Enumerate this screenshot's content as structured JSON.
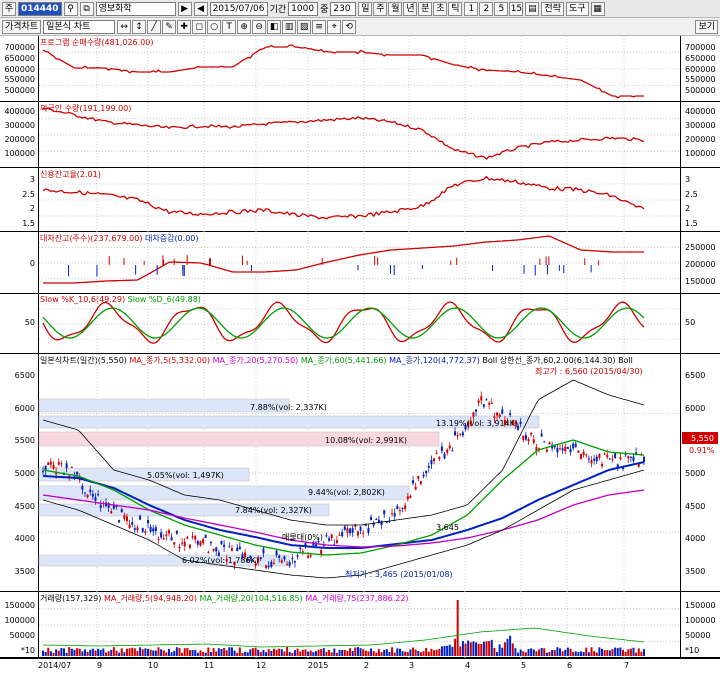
{
  "toolbar": {
    "code": "014440",
    "stock_name": "영보화학",
    "date": "2015/07/06",
    "period_label": "기간",
    "period_value": "1000",
    "count_label": "중",
    "count_value": "230",
    "period_buttons": [
      "일",
      "주",
      "월",
      "년",
      "분",
      "초",
      "틱"
    ],
    "minute_buttons": [
      "1",
      "2",
      "5",
      "15"
    ],
    "strategy": "전략",
    "tools": "도구"
  },
  "toolbar2": {
    "price_chart_tab": "가격차트",
    "chart_type": "일본식 차트",
    "view_label": "보기"
  },
  "panels": {
    "program": {
      "title": "프로그램 순매수량(481,026.00)",
      "ticks": [
        "700000",
        "650000",
        "600000",
        "550000",
        "500000"
      ]
    },
    "foreign": {
      "title": "외국인 수량(191,199.00)",
      "ticks": [
        "400000",
        "300000",
        "200000",
        "100000"
      ]
    },
    "credit": {
      "title": "신용잔고율(2.01)",
      "ticks": [
        "3",
        "2.5",
        "2",
        "1.5"
      ]
    },
    "lending": {
      "title": "대차잔고(주수)(237,679.00)",
      "title2": "대차증감(0.00)",
      "ticks_left": [
        "0"
      ],
      "ticks_right": [
        "250000",
        "200000",
        "150000"
      ]
    },
    "stoch": {
      "title": "Slow %K_10,6(49.29)",
      "title2": "Slow %D_6(49.88)",
      "ticks": [
        "50"
      ]
    },
    "price": {
      "title": "일본식차트(일간)(5,550)",
      "ma1": "MA_종가,5(5,332.00)",
      "ma2": "MA_종가,20(5,270.50)",
      "ma3": "MA_종가,60(5,441.66)",
      "ma4": "MA_종가,120(4,772.37)",
      "boll": "Boll 상한선_종가,60,2.00(6,144.30)",
      "boll2": "Boll",
      "ticks": [
        "6500",
        "6000",
        "5500",
        "5000",
        "4500",
        "4000",
        "3500"
      ],
      "current_price": "5,550",
      "change_pct": "0.91%",
      "high_label": "최고가 : 6,560 (2015/04/30)",
      "low_label": "최저가 : 3,465 (2015/01/08)",
      "zones": [
        "7.88%(vol: 2,337K)",
        "13.19%(vol: 3,914K)",
        "10.08%(vol: 2,991K)",
        "5.05%(vol: 1,497K)",
        "9.44%(vol: 2,802K)",
        "7.84%(vol: 2,327K)",
        "6.02%(vol: 1,786K)"
      ],
      "annot1": "매물대(0%)",
      "annot2": "3,645"
    },
    "volume": {
      "title": "거래량(157,329)",
      "ma1": "MA_거래량,5(94,948.20)",
      "ma2": "MA_거래량,20(104,516.85)",
      "ma3": "MA_거래량,75(237,886.22)",
      "ticks": [
        "150000",
        "100000",
        "50000"
      ],
      "unit": "*10"
    }
  },
  "xaxis": [
    "2014/07",
    "9",
    "10",
    "11",
    "12",
    "2015",
    "2",
    "3",
    "4",
    "5",
    "6",
    "7"
  ],
  "colors": {
    "red": "#d00000",
    "blue": "#0020c0",
    "green": "#00a000",
    "magenta": "#c000c0",
    "zone_blue": "#dce6f8",
    "zone_pink": "#f8d8e0"
  }
}
